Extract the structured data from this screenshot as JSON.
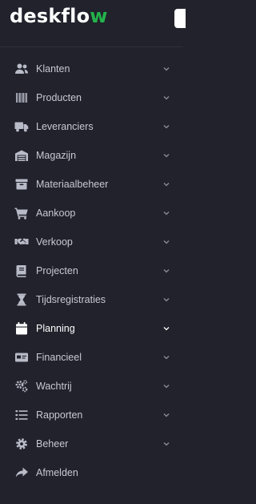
{
  "logo": {
    "text_main": "deskflo",
    "text_accent": "w"
  },
  "colors": {
    "background": "#21222b",
    "text": "#c7c9d3",
    "icon": "#b9bcc8",
    "accent": "#23b24b",
    "active_text": "#ffffff"
  },
  "nav": {
    "items": [
      {
        "label": "Klanten",
        "icon": "users-icon"
      },
      {
        "label": "Producten",
        "icon": "barcode-icon"
      },
      {
        "label": "Leveranciers",
        "icon": "truck-icon"
      },
      {
        "label": "Magazijn",
        "icon": "warehouse-icon"
      },
      {
        "label": "Materiaalbeheer",
        "icon": "archive-box-icon"
      },
      {
        "label": "Aankoop",
        "icon": "shopping-cart-icon"
      },
      {
        "label": "Verkoop",
        "icon": "handshake-icon"
      },
      {
        "label": "Projecten",
        "icon": "book-icon"
      },
      {
        "label": "Tijdsregistraties",
        "icon": "hourglass-icon"
      },
      {
        "label": "Planning",
        "icon": "calendar-icon",
        "active": true
      },
      {
        "label": "Financieel",
        "icon": "id-card-icon"
      },
      {
        "label": "Wachtrij",
        "icon": "cogs-icon"
      },
      {
        "label": "Rapporten",
        "icon": "list-icon"
      },
      {
        "label": "Beheer",
        "icon": "gear-icon"
      },
      {
        "label": "Afmelden",
        "icon": "share-arrow-icon"
      }
    ]
  }
}
